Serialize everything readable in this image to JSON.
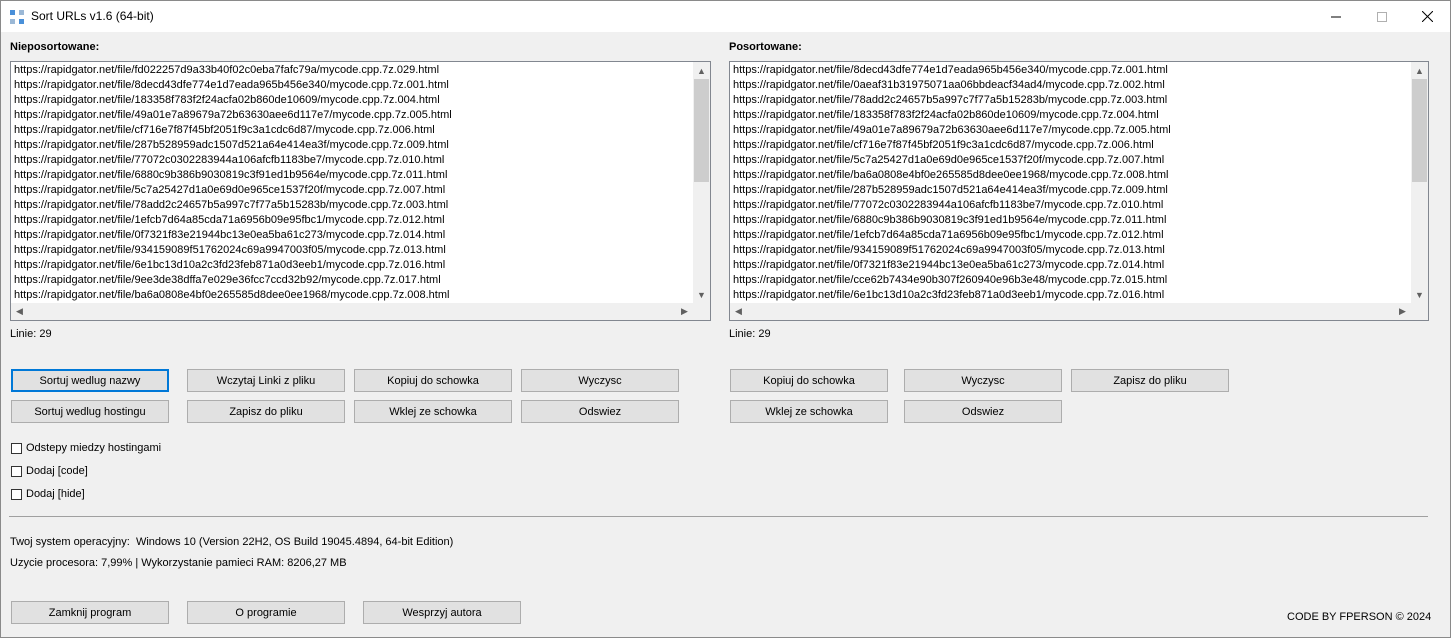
{
  "window": {
    "title": "Sort URLs v1.6 (64-bit)"
  },
  "left_panel": {
    "label": "Nieposortowane:",
    "lines": [
      "https://rapidgator.net/file/fd022257d9a33b40f02c0eba7fafc79a/mycode.cpp.7z.029.html",
      "https://rapidgator.net/file/8decd43dfe774e1d7eada965b456e340/mycode.cpp.7z.001.html",
      "https://rapidgator.net/file/183358f783f2f24acfa02b860de10609/mycode.cpp.7z.004.html",
      "https://rapidgator.net/file/49a01e7a89679a72b63630aee6d117e7/mycode.cpp.7z.005.html",
      "https://rapidgator.net/file/cf716e7f87f45bf2051f9c3a1cdc6d87/mycode.cpp.7z.006.html",
      "https://rapidgator.net/file/287b528959adc1507d521a64e414ea3f/mycode.cpp.7z.009.html",
      "https://rapidgator.net/file/77072c0302283944a106afcfb1183be7/mycode.cpp.7z.010.html",
      "https://rapidgator.net/file/6880c9b386b9030819c3f91ed1b9564e/mycode.cpp.7z.011.html",
      "https://rapidgator.net/file/5c7a25427d1a0e69d0e965ce1537f20f/mycode.cpp.7z.007.html",
      "https://rapidgator.net/file/78add2c24657b5a997c7f77a5b15283b/mycode.cpp.7z.003.html",
      "https://rapidgator.net/file/1efcb7d64a85cda71a6956b09e95fbc1/mycode.cpp.7z.012.html",
      "https://rapidgator.net/file/0f7321f83e21944bc13e0ea5ba61c273/mycode.cpp.7z.014.html",
      "https://rapidgator.net/file/934159089f51762024c69a9947003f05/mycode.cpp.7z.013.html",
      "https://rapidgator.net/file/6e1bc13d10a2c3fd23feb871a0d3eeb1/mycode.cpp.7z.016.html",
      "https://rapidgator.net/file/9ee3de38dffa7e029e36fcc7ccd32b92/mycode.cpp.7z.017.html",
      "https://rapidgator.net/file/ba6a0808e4bf0e265585d8dee0ee1968/mycode.cpp.7z.008.html"
    ],
    "line_count": "Linie: 29"
  },
  "right_panel": {
    "label": "Posortowane:",
    "lines": [
      "https://rapidgator.net/file/8decd43dfe774e1d7eada965b456e340/mycode.cpp.7z.001.html",
      "https://rapidgator.net/file/0aeaf31b31975071aa06bbdeacf34ad4/mycode.cpp.7z.002.html",
      "https://rapidgator.net/file/78add2c24657b5a997c7f77a5b15283b/mycode.cpp.7z.003.html",
      "https://rapidgator.net/file/183358f783f2f24acfa02b860de10609/mycode.cpp.7z.004.html",
      "https://rapidgator.net/file/49a01e7a89679a72b63630aee6d117e7/mycode.cpp.7z.005.html",
      "https://rapidgator.net/file/cf716e7f87f45bf2051f9c3a1cdc6d87/mycode.cpp.7z.006.html",
      "https://rapidgator.net/file/5c7a25427d1a0e69d0e965ce1537f20f/mycode.cpp.7z.007.html",
      "https://rapidgator.net/file/ba6a0808e4bf0e265585d8dee0ee1968/mycode.cpp.7z.008.html",
      "https://rapidgator.net/file/287b528959adc1507d521a64e414ea3f/mycode.cpp.7z.009.html",
      "https://rapidgator.net/file/77072c0302283944a106afcfb1183be7/mycode.cpp.7z.010.html",
      "https://rapidgator.net/file/6880c9b386b9030819c3f91ed1b9564e/mycode.cpp.7z.011.html",
      "https://rapidgator.net/file/1efcb7d64a85cda71a6956b09e95fbc1/mycode.cpp.7z.012.html",
      "https://rapidgator.net/file/934159089f51762024c69a9947003f05/mycode.cpp.7z.013.html",
      "https://rapidgator.net/file/0f7321f83e21944bc13e0ea5ba61c273/mycode.cpp.7z.014.html",
      "https://rapidgator.net/file/cce62b7434e90b307f260940e96b3e48/mycode.cpp.7z.015.html",
      "https://rapidgator.net/file/6e1bc13d10a2c3fd23feb871a0d3eeb1/mycode.cpp.7z.016.html"
    ],
    "line_count": "Linie: 29"
  },
  "left_buttons": {
    "sort_by_name": "Sortuj wedlug nazwy",
    "sort_by_host": "Sortuj wedlug hostingu",
    "load_links": "Wczytaj Linki z pliku",
    "save_to_file": "Zapisz do pliku",
    "copy_clipboard": "Kopiuj do schowka",
    "paste_clipboard": "Wklej ze schowka",
    "clear": "Wyczysc",
    "refresh": "Odswiez"
  },
  "right_buttons": {
    "copy_clipboard": "Kopiuj do schowka",
    "clear": "Wyczysc",
    "save_to_file": "Zapisz do pliku",
    "paste_clipboard": "Wklej ze schowka",
    "refresh": "Odswiez"
  },
  "options": {
    "spacing_between_hosts": "Odstepy miedzy hostingami",
    "add_code": "Dodaj [code]",
    "add_hide": "Dodaj [hide]"
  },
  "system": {
    "os_label": "Twoj system operacyjny:",
    "os_value": "Windows 10 (Version 22H2, OS Build 19045.4894, 64-bit Edition)",
    "usage": "Uzycie procesora: 7,99% | Wykorzystanie pamieci RAM: 8206,27 MB"
  },
  "footer": {
    "close_program": "Zamknij program",
    "about": "O programie",
    "support_author": "Wesprzyj autora",
    "credit": "CODE BY FPERSON © 2024"
  }
}
